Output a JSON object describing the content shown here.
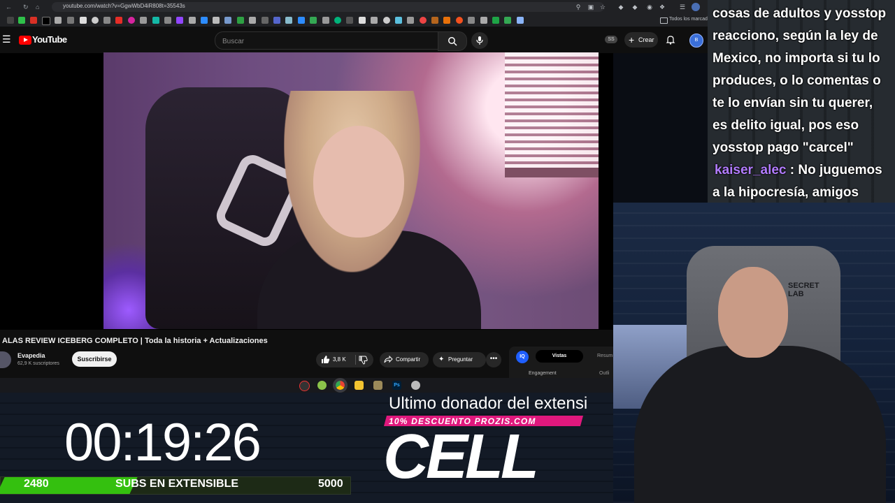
{
  "browser": {
    "url": "youtube.com/watch?v=GgwWbD4iR808t=35543s",
    "bookmarks_folder": "Todos los marcador"
  },
  "youtube": {
    "brand": "YouTube",
    "search_placeholder": "Buscar",
    "ss_badge": "SS",
    "create_label": "Crear",
    "avatar_text": "B"
  },
  "video": {
    "title": "ALAS REVIEW ICEBERG COMPLETO | Toda la historia + Actualizaciones",
    "channel_name": "Evapedia",
    "channel_subs": "62,9 K suscriptores",
    "subscribe_label": "Suscribirse",
    "like_count": "3,8 K",
    "share_label": "Compartir",
    "ask_label": "Preguntar",
    "more_label": "•••"
  },
  "extension_panel": {
    "logo": "IQ",
    "tab_views": "Vistas",
    "tab_summary": "Resum",
    "engagement": "Engagement",
    "outline": "Outli"
  },
  "stream_overlay": {
    "timer": "00:19:26",
    "subs_current": "2480",
    "subs_label": "SUBS EN EXTENSIBLE",
    "subs_goal": "5000",
    "subs_progress": 0.38,
    "donor_label": "Ultimo donador del extensi",
    "promo": "10% DESCUENTO PROZIS.COM",
    "donor_name": "CELL"
  },
  "chat": {
    "line1": "cosas de adultos y yosstop",
    "line2": "reacciono, según la ley de",
    "line3": "Mexico, no importa si tu lo",
    "line4": "produces, o lo comentas o",
    "line5": "te lo envían sin tu querer,",
    "line6": "es delito igual, pos eso",
    "line7": "yosstop pago \"carcel\"",
    "user2": "kaiser_alec",
    "user2_sep": " : ",
    "user2_msg": "No juguemos a la hipocresía, amigos"
  },
  "webcam": {
    "chair_brand_1": "SECRET",
    "chair_brand_2": "LAB"
  },
  "colors": {
    "youtube_red": "#ff0000",
    "subs_green": "#34c00f",
    "promo_pink": "#e0187d",
    "chat_username": "#b27cff"
  }
}
